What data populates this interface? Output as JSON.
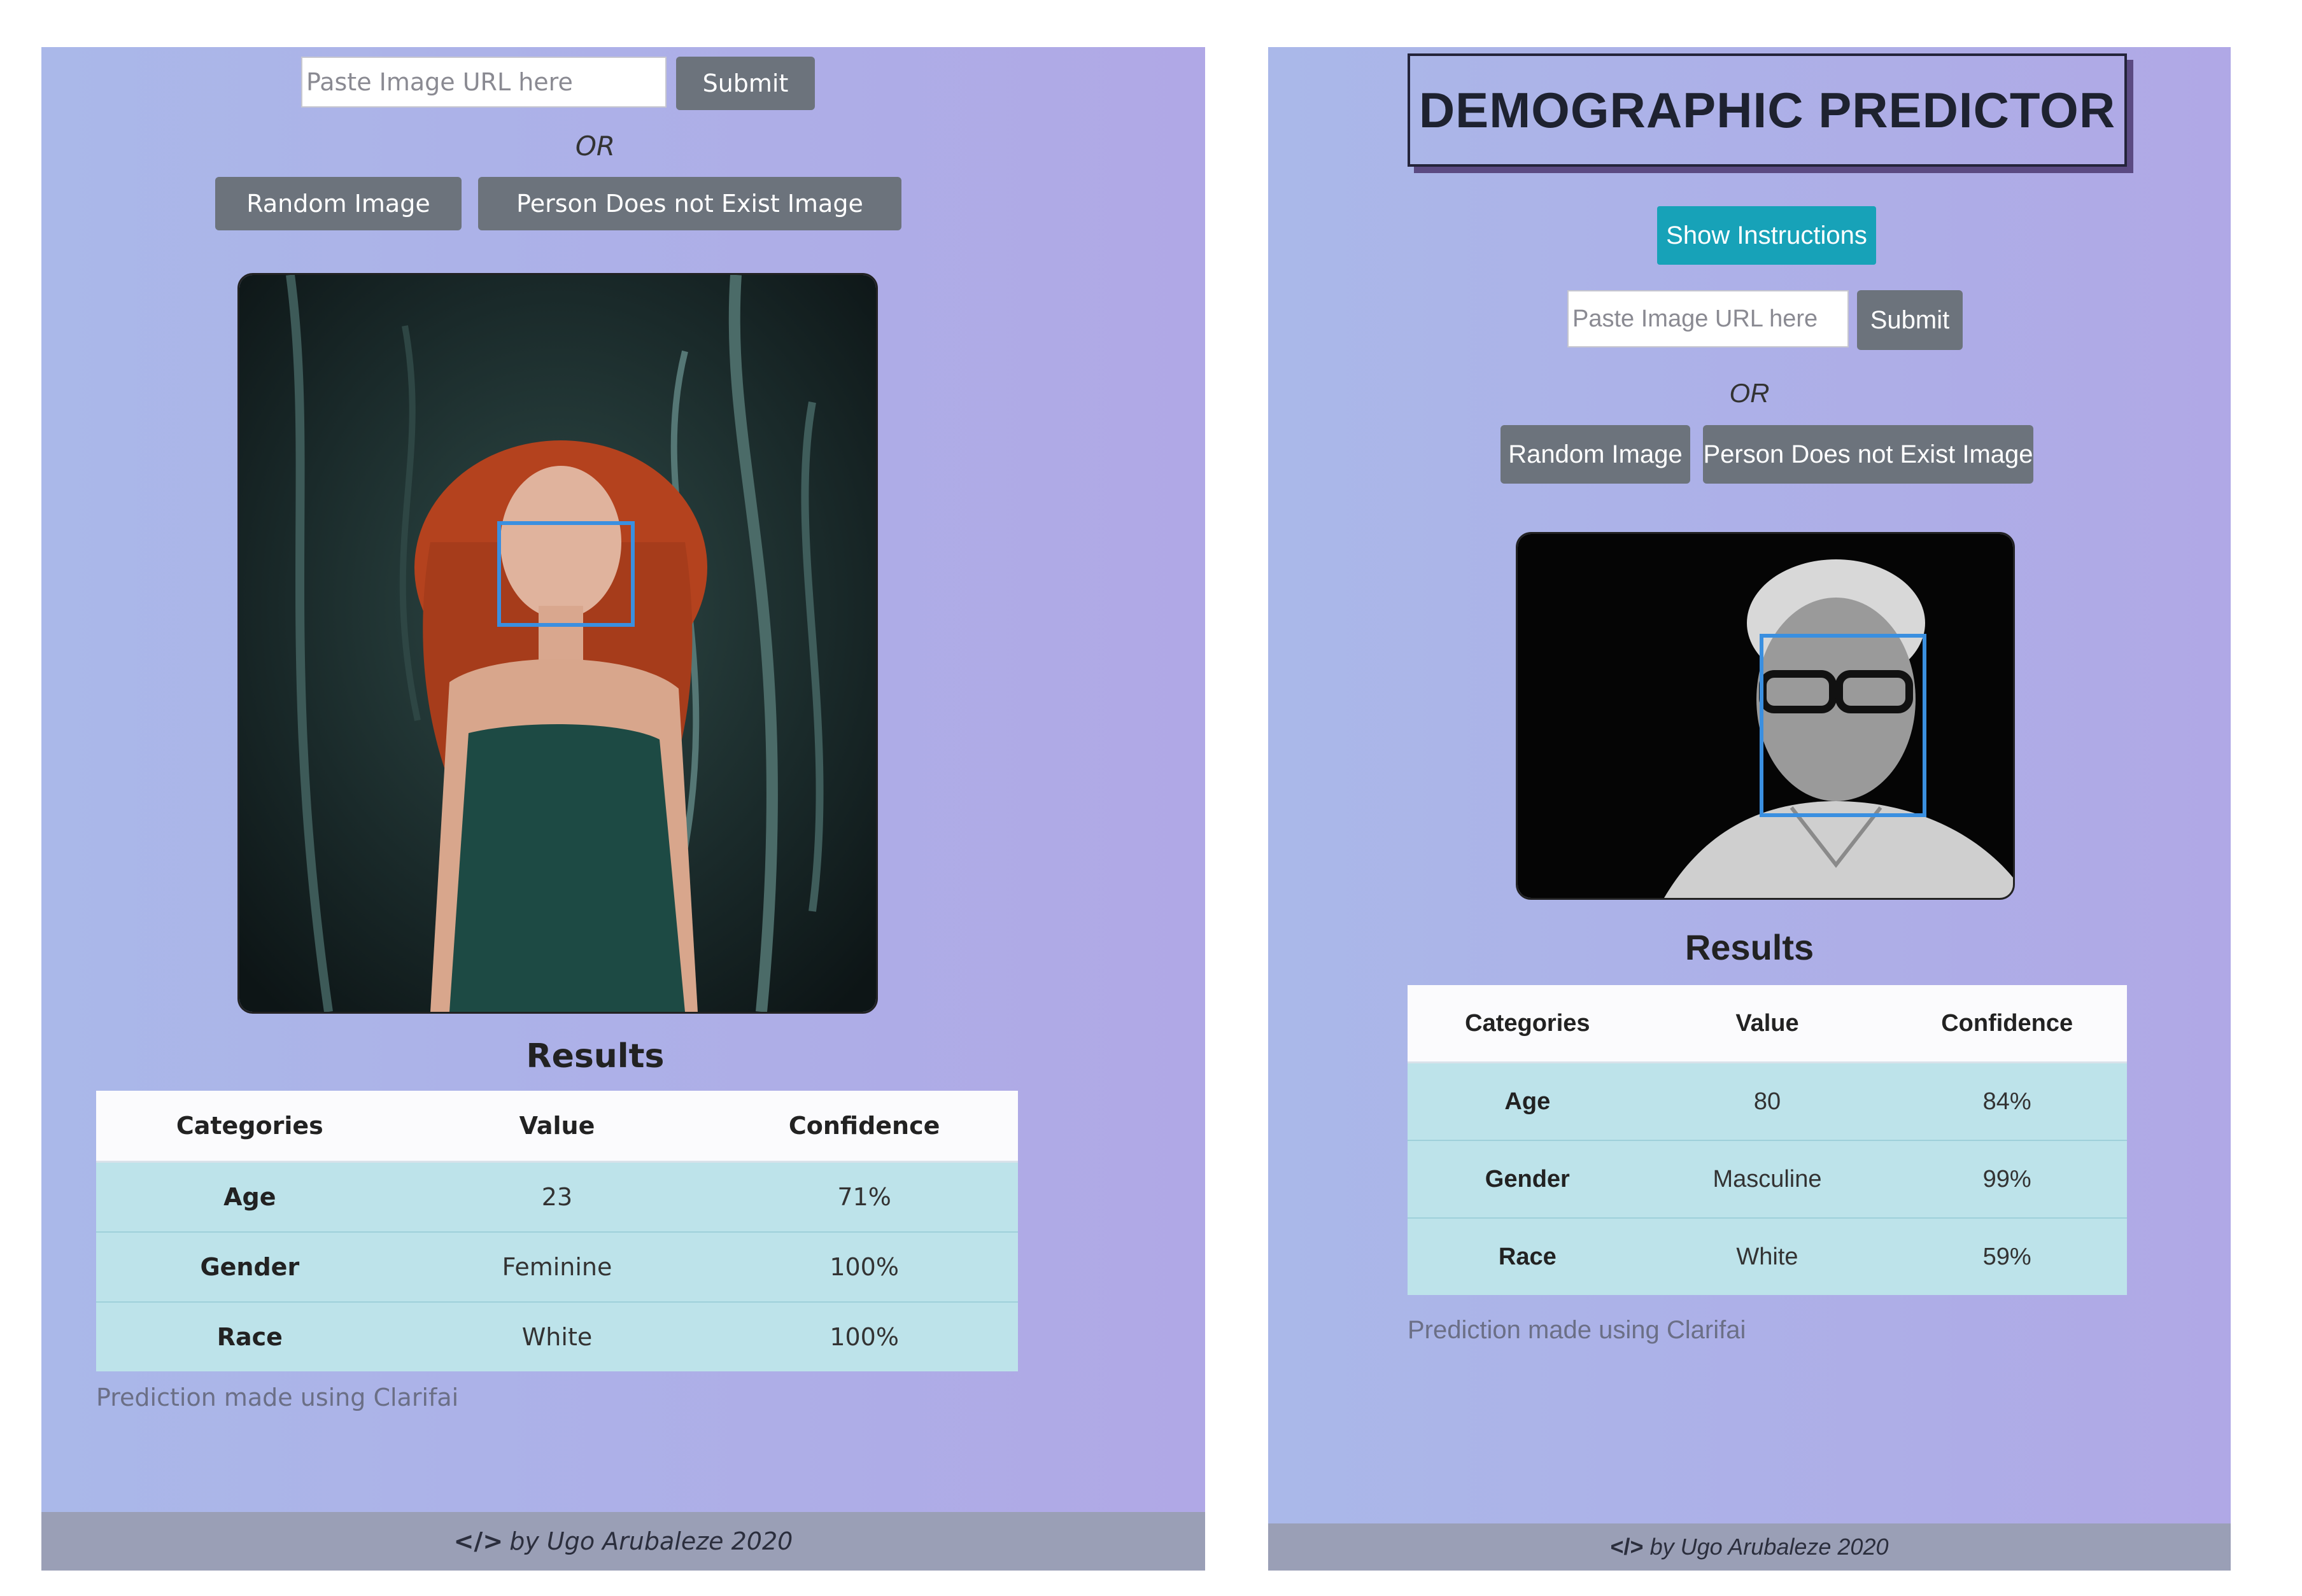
{
  "left": {
    "url_input_placeholder": "Paste Image URL here",
    "submit_label": "Submit",
    "or_text": "OR",
    "random_image_label": "Random Image",
    "person_not_exist_label": "Person Does not Exist Image",
    "results_title": "Results",
    "table": {
      "headers": [
        "Categories",
        "Value",
        "Confidence"
      ],
      "rows": [
        {
          "category": "Age",
          "value": "23",
          "confidence": "71%"
        },
        {
          "category": "Gender",
          "value": "Feminine",
          "confidence": "100%"
        },
        {
          "category": "Race",
          "value": "White",
          "confidence": "100%"
        }
      ]
    },
    "credit": "Prediction made using Clarifai",
    "footer_code": "</>",
    "footer_text": "by Ugo Arubaleze 2020"
  },
  "right": {
    "app_title": "DEMOGRAPHIC PREDICTOR",
    "show_instructions_label": "Show Instructions",
    "url_input_placeholder": "Paste Image URL here",
    "submit_label": "Submit",
    "or_text": "OR",
    "random_image_label": "Random Image",
    "person_not_exist_label": "Person Does not Exist Image",
    "results_title": "Results",
    "table": {
      "headers": [
        "Categories",
        "Value",
        "Confidence"
      ],
      "rows": [
        {
          "category": "Age",
          "value": "80",
          "confidence": "84%"
        },
        {
          "category": "Gender",
          "value": "Masculine",
          "confidence": "99%"
        },
        {
          "category": "Race",
          "value": "White",
          "confidence": "59%"
        }
      ]
    },
    "credit": "Prediction made using Clarifai",
    "footer_code": "</>",
    "footer_text": "by Ugo Arubaleze 2020"
  },
  "colors": {
    "face_box": "#3a8fe0",
    "instructions_button": "#17a2b8",
    "secondary_button": "#6c737c",
    "table_row": "#bde3ea",
    "footer": "#9a9fb6"
  }
}
